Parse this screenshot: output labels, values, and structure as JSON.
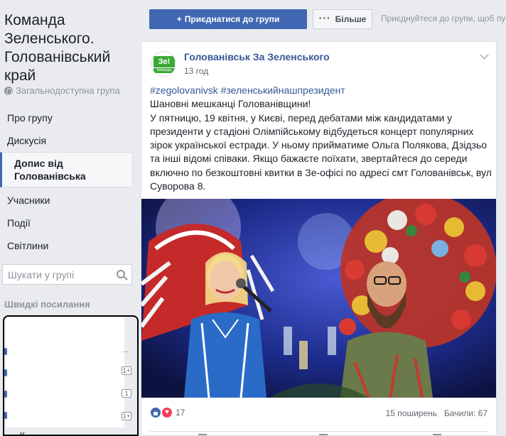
{
  "group": {
    "title": "Команда Зеленського. Голованівський край",
    "visibility": "Загальнодоступна група"
  },
  "nav": {
    "items": [
      {
        "label": "Про групу"
      },
      {
        "label": "Дискусія"
      },
      {
        "label": "Допис від Голованівська",
        "active": true
      },
      {
        "label": "Учасники"
      },
      {
        "label": "Події"
      },
      {
        "label": "Світлини"
      }
    ]
  },
  "search": {
    "placeholder": "Шукати у групі"
  },
  "quick_links": {
    "header": "Швидкі посилання",
    "badges": [
      "1+",
      "1",
      "1+"
    ],
    "bottom_label": "К..."
  },
  "toolbar": {
    "join_label": "Приєднатися до групи",
    "more_label": "Більше",
    "hint": "Приєднуйтеся до групи, щоб публікувати"
  },
  "post": {
    "author": "Голованівськ За Зеленського",
    "time": "13 год",
    "avatar_text": "Зе!",
    "avatar_sub": "Команда",
    "hashtags": "#zegolovanivsk #зеленськийнашпрезидент",
    "body": "Шановні мешканці Голованівщини!\nУ пятницю, 19 квітня, у Києві, перед дебатами між кандидатами у президенти у стадіоні Олімпійському відбудеться концерт популярних зірок української естради. У ньому прийматиме Ольга Полякова, Дзідзьо та інші відомі співаки. Якщо бажаєте поїхати, звертайтеся до середи включно по безкоштовні квитки в Зе-офісі по адресі смт Голованівськ, вул Суворова 8.",
    "reactions_count": "17",
    "shares": "15 поширень",
    "views": "Бачили: 67"
  },
  "colors": {
    "accent": "#4267b2",
    "link": "#365899",
    "background": "#e9ebee",
    "brand_green": "#3aaa35"
  }
}
